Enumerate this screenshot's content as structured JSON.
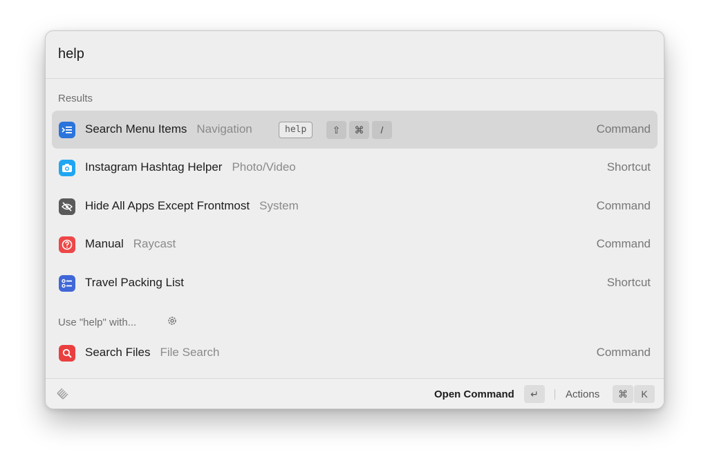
{
  "search": {
    "query": "help"
  },
  "sections": {
    "results_title": "Results",
    "fallback_title": "Use \"help\" with..."
  },
  "results": [
    {
      "title": "Search Menu Items",
      "subtitle": "Navigation",
      "kind": "Command",
      "alias": "help",
      "hotkey": [
        "⇧",
        "⌘",
        "/"
      ],
      "icon": "menu-items-icon",
      "color": "#2a74dc"
    },
    {
      "title": "Instagram Hashtag Helper",
      "subtitle": "Photo/Video",
      "kind": "Shortcut",
      "icon": "camera-icon",
      "color": "#1fa6f2"
    },
    {
      "title": "Hide All Apps Except Frontmost",
      "subtitle": "System",
      "kind": "Command",
      "icon": "hidden-eye-icon",
      "color": "#5a5a5a"
    },
    {
      "title": "Manual",
      "subtitle": "Raycast",
      "kind": "Command",
      "icon": "help-circle-icon",
      "color": "#ee4747"
    },
    {
      "title": "Travel Packing List",
      "subtitle": "",
      "kind": "Shortcut",
      "icon": "checklist-icon",
      "color": "#4067d8"
    }
  ],
  "fallback": [
    {
      "title": "Search Files",
      "subtitle": "File Search",
      "kind": "Command",
      "icon": "magnifier-icon",
      "color": "#ea3f3f"
    }
  ],
  "footer": {
    "primary_action": "Open Command",
    "primary_key": "↵",
    "actions_label": "Actions",
    "actions_keys": [
      "⌘",
      "K"
    ]
  }
}
